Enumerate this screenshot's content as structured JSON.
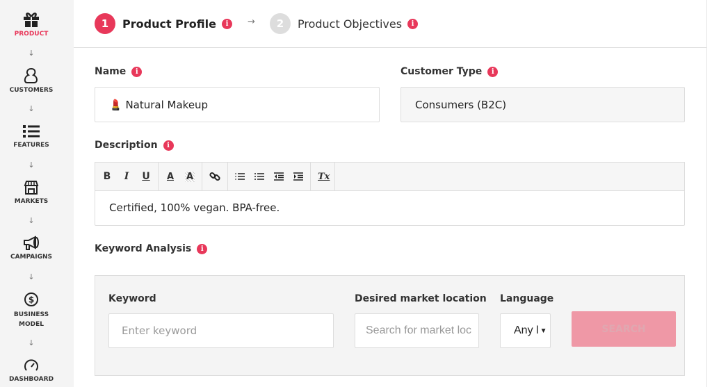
{
  "sidebar": {
    "items": [
      {
        "label": "PRODUCT",
        "icon": "gift-icon"
      },
      {
        "label": "CUSTOMERS",
        "icon": "user-icon"
      },
      {
        "label": "FEATURES",
        "icon": "list-icon"
      },
      {
        "label": "MARKETS",
        "icon": "store-icon"
      },
      {
        "label": "CAMPAIGNS",
        "icon": "megaphone-icon"
      },
      {
        "label": "BUSINESS MODEL",
        "icon": "dollar-icon"
      },
      {
        "label": "DASHBOARD",
        "icon": "gauge-icon"
      }
    ],
    "arrow": "↓",
    "active_color": "#e8385a"
  },
  "steps": [
    {
      "num": "1",
      "label": "Product Profile",
      "active": true
    },
    {
      "num": "2",
      "label": "Product Objectives",
      "active": false
    }
  ],
  "step_arrow": "→",
  "info_glyph": "i",
  "form": {
    "name_label": "Name",
    "name_value": "💄 Natural Makeup",
    "customer_type_label": "Customer Type",
    "customer_type_value": "Consumers (B2C)",
    "description_label": "Description",
    "description_value": "Certified, 100% vegan. BPA-free.",
    "toolbar": [
      "B",
      "I",
      "U",
      "A",
      "A",
      "link",
      "ol",
      "ul",
      "outdent",
      "indent",
      "Tx"
    ]
  },
  "keyword": {
    "section_label": "Keyword Analysis",
    "keyword_label": "Keyword",
    "keyword_placeholder": "Enter keyword",
    "location_label": "Desired market location",
    "location_placeholder": "Search for market loc",
    "language_label": "Language",
    "language_value": "Any l",
    "search_button": "SEARCH"
  }
}
